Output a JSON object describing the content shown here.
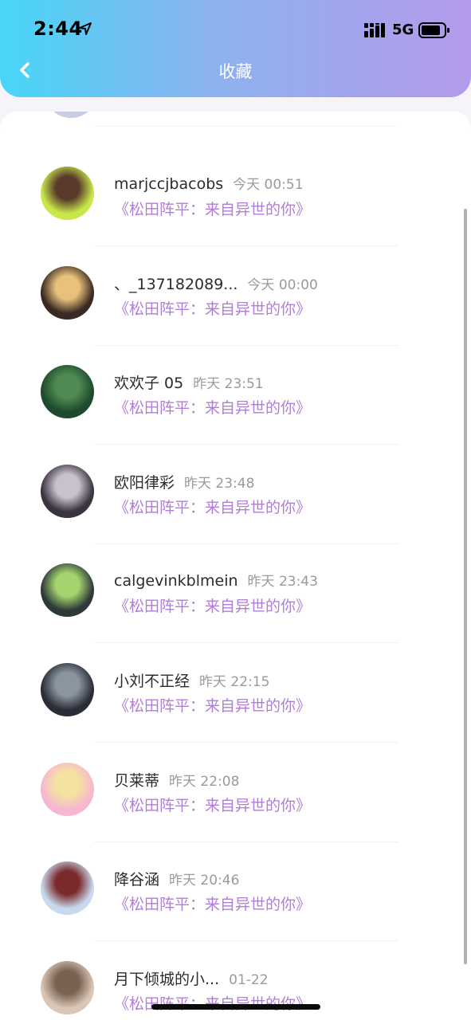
{
  "status_bar": {
    "time": "2:44",
    "network": "5G"
  },
  "nav": {
    "title": "收藏"
  },
  "items": [
    {
      "name": "marjccjbacobs",
      "time": "今天 00:51",
      "subtitle": "《松田阵平：来自异世的你》",
      "avatar_colors": [
        "#c8e84a",
        "#5a3a2c"
      ]
    },
    {
      "name": "、_137182089...",
      "time": "今天 00:00",
      "subtitle": "《松田阵平：来自异世的你》",
      "avatar_colors": [
        "#3b2a24",
        "#e8c27a"
      ]
    },
    {
      "name": "欢欢子 05",
      "time": "昨天 23:51",
      "subtitle": "《松田阵平：来自异世的你》",
      "avatar_colors": [
        "#1d4a2c",
        "#4f8a54"
      ]
    },
    {
      "name": "欧阳律彩",
      "time": "昨天 23:48",
      "subtitle": "《松田阵平：来自异世的你》",
      "avatar_colors": [
        "#3a3340",
        "#c9c2cc"
      ]
    },
    {
      "name": "calgevinkblmein",
      "time": "昨天 23:43",
      "subtitle": "《松田阵平：来自异世的你》",
      "avatar_colors": [
        "#2e3a3a",
        "#a5d46e"
      ]
    },
    {
      "name": "小刘不正经",
      "time": "昨天 22:15",
      "subtitle": "《松田阵平：来自异世的你》",
      "avatar_colors": [
        "#2a2d35",
        "#8b95a0"
      ]
    },
    {
      "name": "贝莱蒂",
      "time": "昨天 22:08",
      "subtitle": "《松田阵平：来自异世的你》",
      "avatar_colors": [
        "#f7b7d0",
        "#f4e3a0"
      ]
    },
    {
      "name": "降谷涵",
      "time": "昨天 20:46",
      "subtitle": "《松田阵平：来自异世的你》",
      "avatar_colors": [
        "#c8d9ee",
        "#7a2a2a"
      ]
    },
    {
      "name": "月下倾城的小...",
      "time": "01-22",
      "subtitle": "《松田阵平：来自异世的你》",
      "avatar_colors": [
        "#d9c6b6",
        "#7a6252"
      ]
    }
  ]
}
